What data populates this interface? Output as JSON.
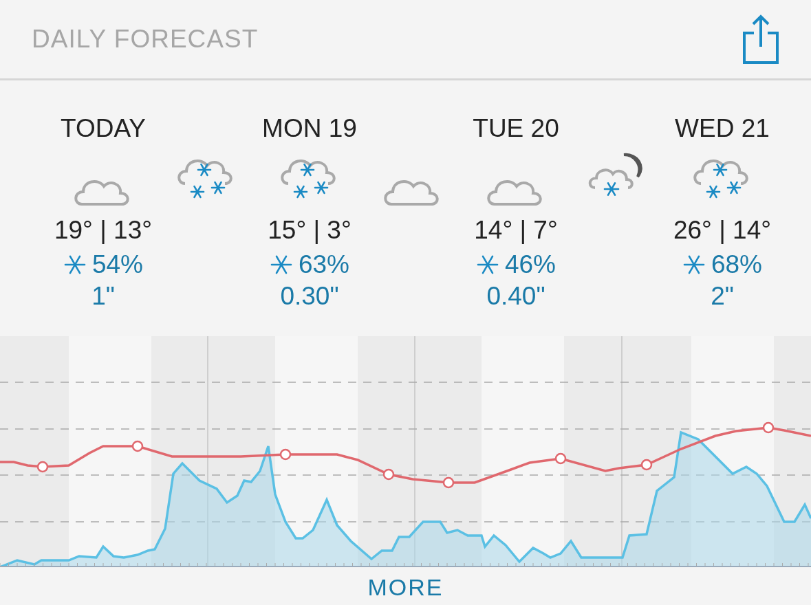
{
  "header": {
    "title": "DAILY FORECAST"
  },
  "days": [
    {
      "label": "TODAY",
      "icons": [
        {
          "kind": "cloud"
        },
        {
          "kind": "snow"
        }
      ],
      "temps": "19° | 13°",
      "chance": "54%",
      "amount": "1\""
    },
    {
      "label": "MON 19",
      "icons": [
        {
          "kind": "snow"
        },
        {
          "kind": "cloud"
        }
      ],
      "temps": "15° | 3°",
      "chance": "63%",
      "amount": "0.30\""
    },
    {
      "label": "TUE 20",
      "icons": [
        {
          "kind": "cloud"
        },
        {
          "kind": "moon-snow"
        }
      ],
      "temps": "14° | 7°",
      "chance": "46%",
      "amount": "0.40\""
    },
    {
      "label": "WED 21",
      "icons": [
        {
          "kind": "snow"
        }
      ],
      "temps": "26° | 14°",
      "chance": "68%",
      "amount": "2\""
    }
  ],
  "more_link": "MORE"
}
